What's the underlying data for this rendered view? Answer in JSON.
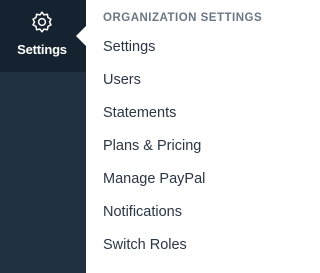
{
  "sidebar": {
    "active_item": {
      "label": "Settings",
      "icon": "gear-icon"
    }
  },
  "menu": {
    "heading": "ORGANIZATION SETTINGS",
    "items": [
      {
        "label": "Settings"
      },
      {
        "label": "Users"
      },
      {
        "label": "Statements"
      },
      {
        "label": "Plans & Pricing"
      },
      {
        "label": "Manage PayPal"
      },
      {
        "label": "Notifications"
      },
      {
        "label": "Switch Roles"
      }
    ]
  },
  "colors": {
    "sidebar_bg": "#203040",
    "sidebar_active_bg": "#152230",
    "menu_bg": "#ffffff",
    "heading_text": "#6b7785",
    "item_text": "#2a3644"
  }
}
